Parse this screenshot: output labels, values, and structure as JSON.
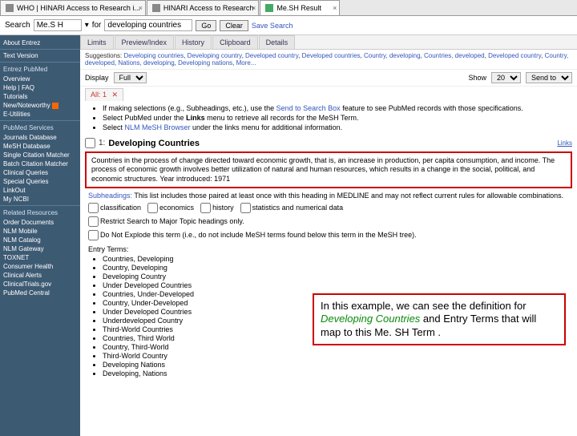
{
  "tabs": [
    {
      "label": "WHO | HINARI Access to Research i..."
    },
    {
      "label": "HINARI Access to Research"
    },
    {
      "label": "Me.SH Result"
    }
  ],
  "search": {
    "label": "Search",
    "query": "Me.S H",
    "for_label": "for",
    "for_value": "developing countries",
    "go": "Go",
    "clear": "Clear",
    "save": "Save Search"
  },
  "sidebar": {
    "about": "About Entrez",
    "text_version": "Text Version",
    "sec_entrez": "Entrez PubMed",
    "entrez_items": [
      "Overview",
      "Help | FAQ",
      "Tutorials",
      "New/Noteworthy",
      "E-Utilities"
    ],
    "sec_pub": "PubMed Services",
    "pub_items": [
      "Journals Database",
      "MeSH Database",
      "Single Citation Matcher",
      "Batch Citation Matcher",
      "Clinical Queries",
      "Special Queries",
      "LinkOut",
      "My NCBI"
    ],
    "sec_rel": "Related Resources",
    "rel_items": [
      "Order Documents",
      "NLM Mobile",
      "NLM Catalog",
      "NLM Gateway",
      "TOXNET",
      "Consumer Health",
      "Clinical Alerts",
      "ClinicalTrials.gov",
      "PubMed Central"
    ]
  },
  "subtabs": [
    "Limits",
    "Preview/Index",
    "History",
    "Clipboard",
    "Details"
  ],
  "suggestion": {
    "label": "Suggestions:",
    "links": [
      "Developing countries",
      "Developing country",
      "Developed country",
      "Developed countries",
      "Country, developing",
      "Countries, developed",
      "Developed country",
      "Country, developed",
      "Nations, developing",
      "Developing nations"
    ],
    "more": "More..."
  },
  "display": {
    "label": "Display",
    "mode": "Full",
    "show_label": "Show",
    "show_val": "20",
    "sendto": "Send to"
  },
  "alltab": {
    "label": "All: 1"
  },
  "bullets": [
    {
      "pre": "If making selections (e.g., Subheadings, etc.), use the ",
      "link": "Send to Search Box",
      "post": " feature to see PubMed records with those specifications."
    },
    {
      "pre": "Select PubMed under the ",
      "bold": "Links",
      "post": " menu to retrieve all records for the MeSH Term."
    },
    {
      "pre": "Select ",
      "link": "NLM MeSH Browser",
      "post": " under the links menu for additional information."
    }
  ],
  "result": {
    "num": "1:",
    "title": "Developing Countries",
    "links": "Links",
    "definition": "Countries in the process of change directed toward economic growth, that is, an increase in production, per capita consumption, and income. The process of economic growth involves better utilization of natural and human resources, which results in a change in the social, political, and economic structures. Year introduced: 1971"
  },
  "subheadings": {
    "label": "Subheadings:",
    "text": " This list includes those paired at least once with this heading in MEDLINE and may not reflect current rules for allowable combinations."
  },
  "sub_checks": [
    "classification",
    "economics",
    "history",
    "statistics and numerical data"
  ],
  "restrict": "Restrict Search to Major Topic headings only.",
  "noexplode": "Do Not Explode this term (i.e., do not include MeSH terms found below this term in the MeSH tree).",
  "entry": {
    "label": "Entry Terms:",
    "list": [
      "Countries, Developing",
      "Country, Developing",
      "Developing Country",
      "Under Developed Countries",
      "Countries, Under-Developed",
      "Country, Under-Developed",
      "Under Developed Countries",
      "Underdeveloped Country",
      "Third-World Countries",
      "Countries, Third World",
      "Country, Third-World",
      "Third-World Country",
      "Developing Nations",
      "Developing, Nations"
    ]
  },
  "annotation": {
    "line1": "In this example, we can see the definition for ",
    "highlight": "Developing Countries",
    "line2": " and Entry Terms that will map to this Me. SH Term ."
  }
}
